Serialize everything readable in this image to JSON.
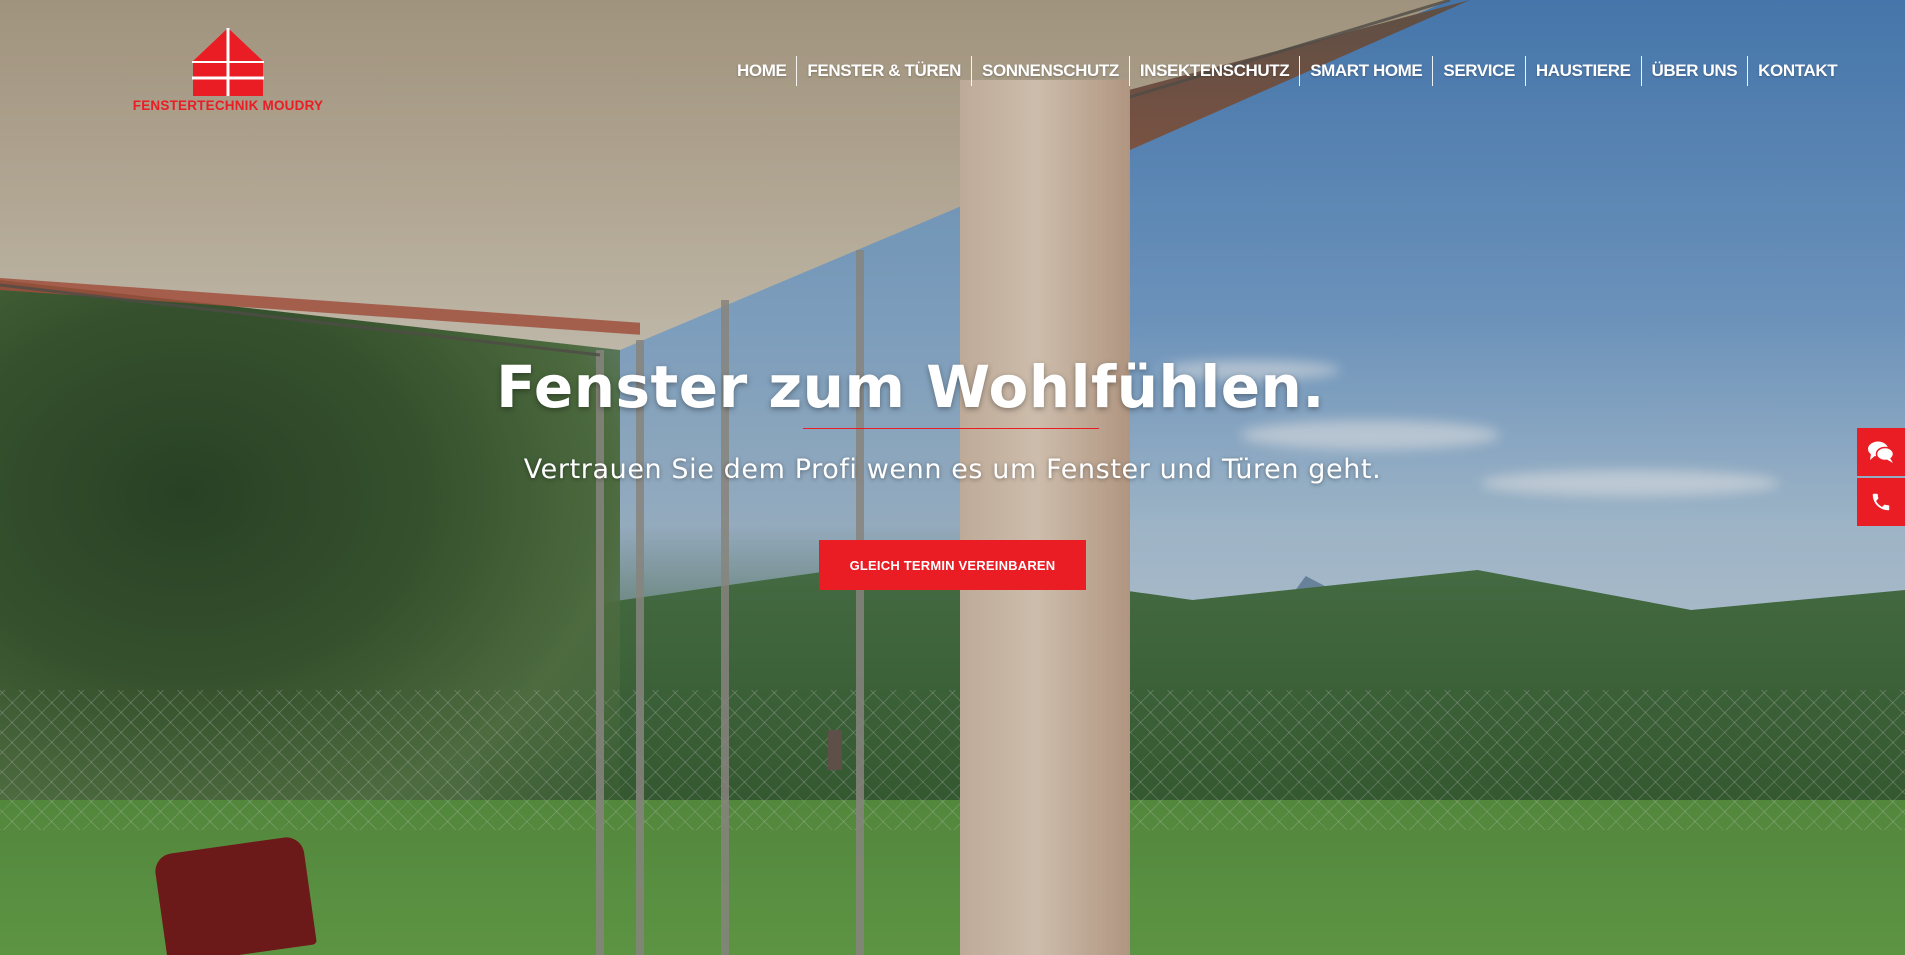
{
  "brand": {
    "name": "FENSTERTECHNIK MOUDRY",
    "accent_color": "#ea1c24"
  },
  "nav": {
    "items": [
      {
        "label": "HOME"
      },
      {
        "label": "FENSTER & TÜREN"
      },
      {
        "label": "SONNENSCHUTZ"
      },
      {
        "label": "INSEKTENSCHUTZ"
      },
      {
        "label": "SMART HOME"
      },
      {
        "label": "SERVICE"
      },
      {
        "label": "HAUSTIERE"
      },
      {
        "label": "ÜBER UNS"
      },
      {
        "label": "KONTAKT"
      }
    ]
  },
  "hero": {
    "headline": "Fenster zum Wohlfühlen.",
    "subline": "Vertrauen Sie dem Profi wenn es um Fenster und Türen geht.",
    "cta_label": "GLEICH TERMIN VEREINBAREN"
  },
  "side_widgets": {
    "chat_icon": "chat-bubbles-icon",
    "phone_icon": "phone-icon"
  }
}
